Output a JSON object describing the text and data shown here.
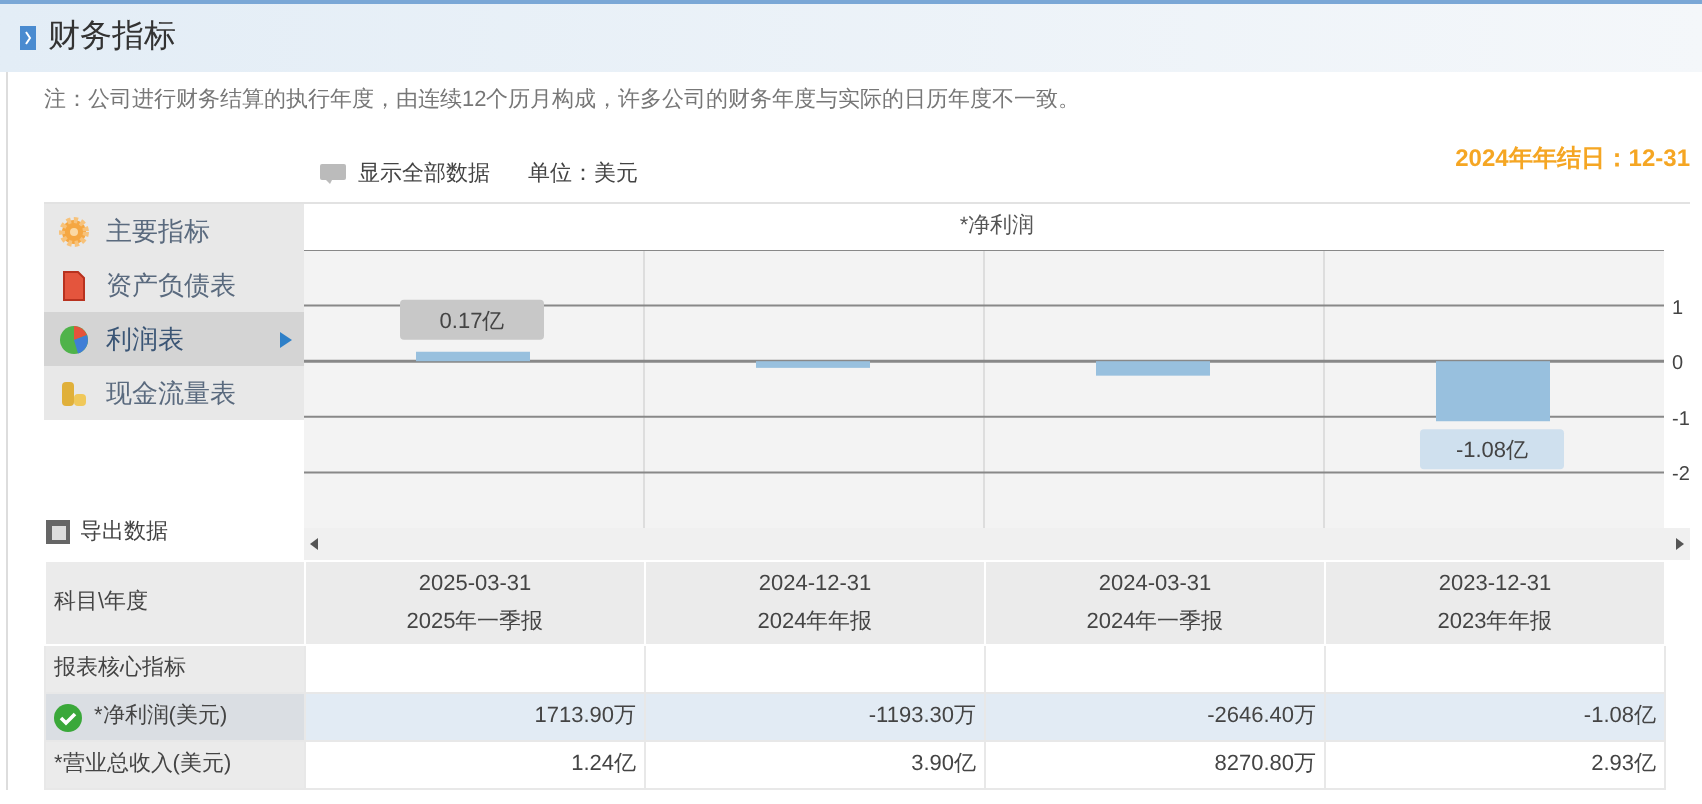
{
  "header": {
    "title": "财务指标"
  },
  "note": "注：公司进行财务结算的执行年度，由连续12个历月构成，许多公司的财务年度与实际的日历年度不一致。",
  "toolbar": {
    "show_all": "显示全部数据",
    "unit": "单位：美元",
    "year_end": "2024年年结日：12-31"
  },
  "sidebar": {
    "items": [
      {
        "label": "主要指标",
        "kind": "gear",
        "selected": false
      },
      {
        "label": "资产负债表",
        "kind": "sheet",
        "selected": false
      },
      {
        "label": "利润表",
        "kind": "pie",
        "selected": true
      },
      {
        "label": "现金流量表",
        "kind": "coins",
        "selected": false
      }
    ],
    "export": "导出数据"
  },
  "chart": {
    "chart_data": {
      "type": "bar",
      "title": "*净利润",
      "grid": true,
      "values": [
        0.17,
        -0.12,
        -0.26,
        -1.08
      ],
      "ylim": [
        -3,
        2
      ],
      "yticks": [
        1,
        0,
        -1,
        -2
      ],
      "value_labels": [
        "0.17亿",
        null,
        null,
        "-1.08亿"
      ]
    }
  },
  "table": {
    "corner": "科目\\年度",
    "columns": [
      {
        "date": "2025-03-31",
        "period": "2025年一季报"
      },
      {
        "date": "2024-12-31",
        "period": "2024年年报"
      },
      {
        "date": "2024-03-31",
        "period": "2024年一季报"
      },
      {
        "date": "2023-12-31",
        "period": "2023年年报"
      }
    ],
    "rows": [
      {
        "label": "报表核心指标",
        "kind": "section",
        "selected": false,
        "values": []
      },
      {
        "label": "*净利润(美元)",
        "kind": "item",
        "selected": true,
        "values": [
          "1713.90万",
          "-1193.30万",
          "-2646.40万",
          "-1.08亿"
        ]
      },
      {
        "label": "*营业总收入(美元)",
        "kind": "item",
        "selected": false,
        "values": [
          "1.24亿",
          "3.90亿",
          "8270.80万",
          "2.93亿"
        ]
      }
    ]
  }
}
